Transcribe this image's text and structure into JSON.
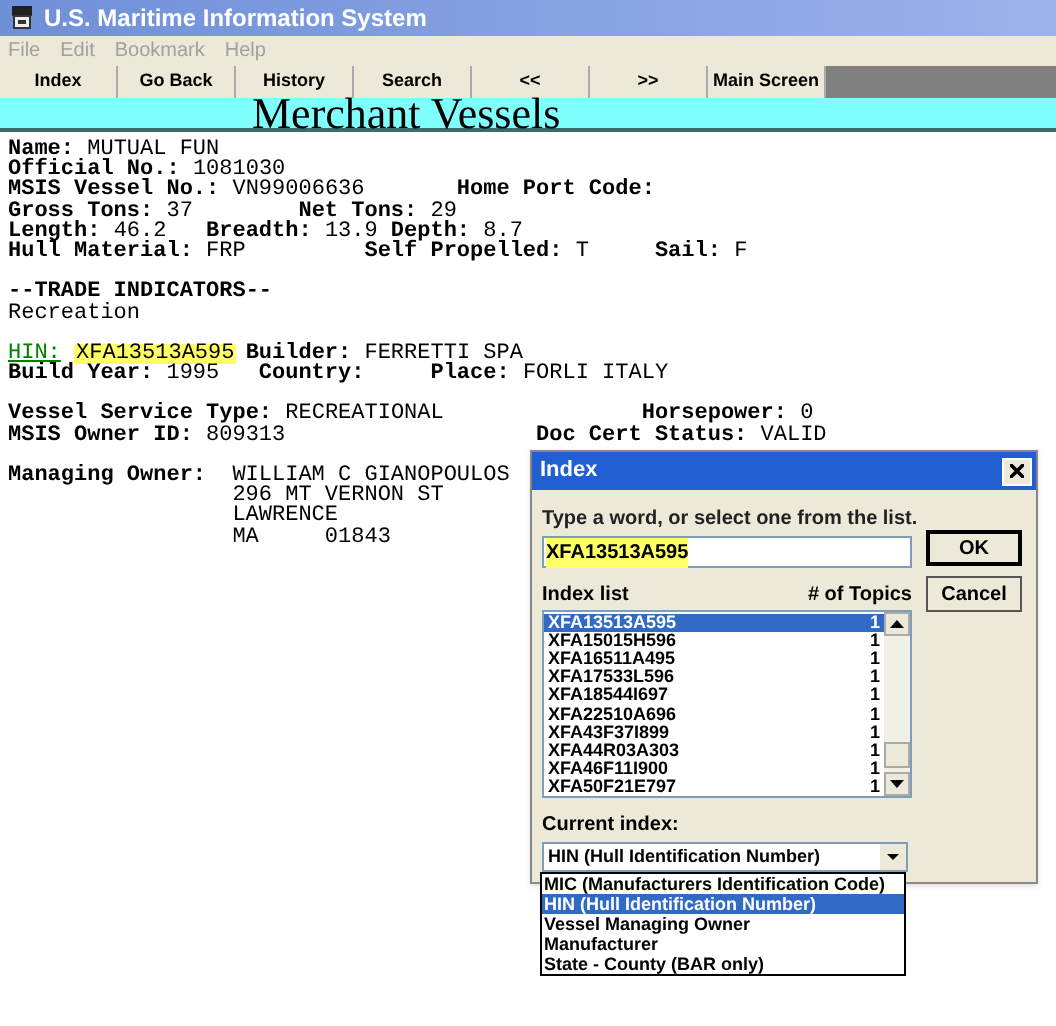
{
  "window": {
    "title": "U.S. Maritime Information System"
  },
  "menu": [
    {
      "label": "File",
      "disabled": true
    },
    {
      "label": "Edit",
      "disabled": true
    },
    {
      "label": "Bookmark",
      "disabled": true
    },
    {
      "label": "Help",
      "disabled": true
    }
  ],
  "toolbar": [
    "Index",
    "Go Back",
    "History",
    "Search",
    "<<",
    ">>",
    "Main Screen"
  ],
  "banner": "Merchant Vessels",
  "record": [
    [
      [
        {
          "label": "Name:",
          "value": "MUTUAL FUN"
        }
      ],
      [
        {
          "label": "Official No.:",
          "value": "1081030"
        }
      ],
      [
        {
          "label": "MSIS Vessel No.:",
          "value": "VN99006636"
        },
        {
          "label": "Home Port Code:"
        }
      ],
      [
        {
          "label": "Gross Tons:",
          "value": "37"
        },
        {
          "label": "Net Tons:",
          "value": "29"
        }
      ],
      [
        {
          "label": "Length:",
          "value": "46.2"
        },
        {
          "label": "Breadth:",
          "value": "13.9"
        },
        {
          "label": "Depth:",
          "value": "8.7"
        }
      ],
      [
        {
          "label": "Hull Material:",
          "value": "FRP"
        },
        {
          "label": "Self Propelled:",
          "value": "T"
        },
        {
          "label": "Sail:",
          "value": "F"
        }
      ]
    ],
    [
      [
        {
          "label": "--TRADE INDICATORS--"
        }
      ],
      [
        {
          "kind": "plain",
          "value": "Recreation"
        }
      ]
    ],
    [
      [
        {
          "kind": "link",
          "label": "HIN:",
          "value": "XFA13513A595",
          "highlighted": true
        },
        {
          "label": "Builder:",
          "value": "FERRETTI SPA"
        }
      ],
      [
        {
          "label": "Build Year:",
          "value": "1995"
        },
        {
          "label": "Country:"
        },
        {
          "label": "Place:",
          "value": "FORLI ITALY"
        }
      ]
    ],
    [
      [
        {
          "label": "Vessel Service Type:",
          "value": "RECREATIONAL"
        },
        {
          "label": "Horsepower:",
          "value": "0"
        }
      ],
      [
        {
          "label": "MSIS Owner ID:",
          "value": "809313"
        },
        {
          "label": "Doc Cert Status:",
          "value": "VALID"
        }
      ]
    ]
  ],
  "managing_owner": {
    "label": "Managing Owner:",
    "lines": [
      "WILLIAM C GIANOPOULOS",
      "296 MT VERNON ST",
      "LAWRENCE",
      "MA     01843"
    ]
  },
  "dialog": {
    "title": "Index",
    "prompt": "Type a word, or select one from the list.",
    "value": "XFA13513A595",
    "buttons": [
      "OK",
      "Cancel"
    ],
    "list_header": "Index list",
    "count_header": "# of Topics",
    "items": [
      {
        "name": "XFA13513A595",
        "count": "1",
        "selected": true
      },
      {
        "name": "XFA15015H596",
        "count": "1",
        "selected": false
      },
      {
        "name": "XFA16511A495",
        "count": "1",
        "selected": false
      },
      {
        "name": "XFA17533L596",
        "count": "1",
        "selected": false
      },
      {
        "name": "XFA18544I697",
        "count": "1",
        "selected": false
      },
      {
        "name": "XFA22510A696",
        "count": "1",
        "selected": false
      },
      {
        "name": "XFA43F37I899",
        "count": "1",
        "selected": false
      },
      {
        "name": "XFA44R03A303",
        "count": "1",
        "selected": false
      },
      {
        "name": "XFA46F11I900",
        "count": "1",
        "selected": false
      },
      {
        "name": "XFA50F21E797",
        "count": "1",
        "selected": false
      }
    ],
    "current_label": "Current index:",
    "current_value": "HIN (Hull Identification Number)",
    "options": [
      {
        "label": "MIC (Manufacturers Identification Code)",
        "selected": false
      },
      {
        "label": "HIN (Hull Identification Number)",
        "selected": true
      },
      {
        "label": "Vessel Managing Owner",
        "selected": false
      },
      {
        "label": "Manufacturer",
        "selected": false
      },
      {
        "label": "State - County (BAR only)",
        "selected": false
      }
    ]
  }
}
